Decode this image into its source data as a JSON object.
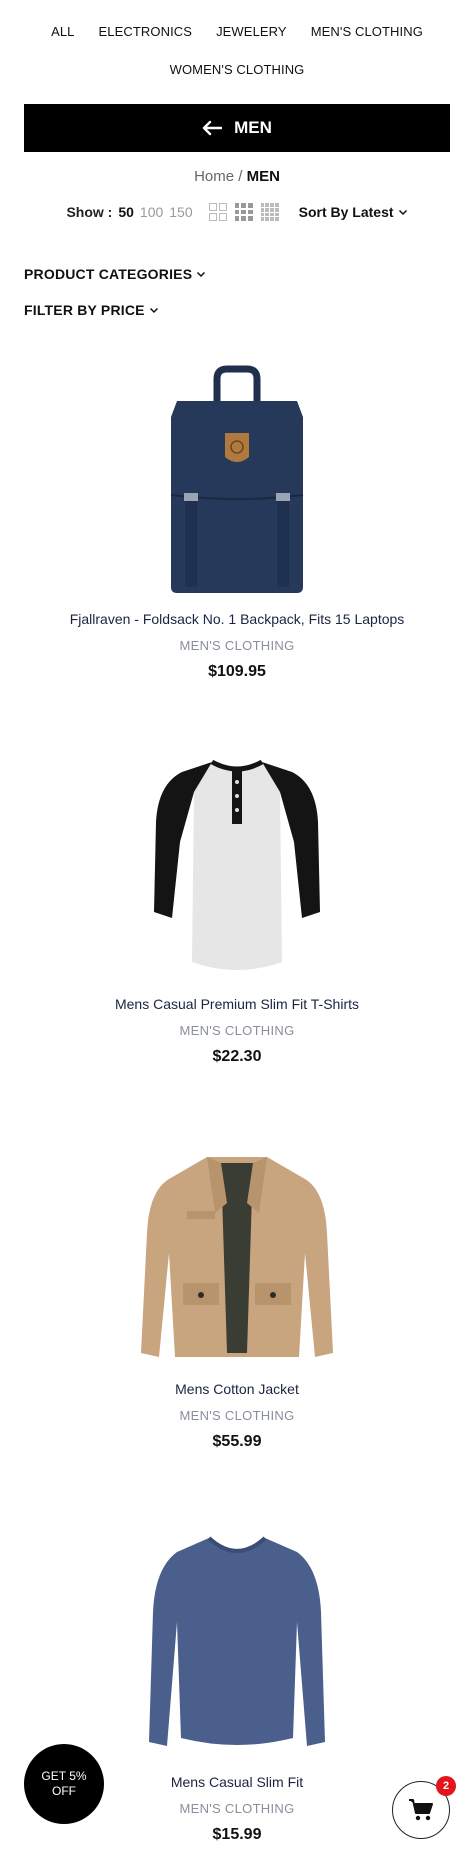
{
  "category_nav": {
    "items": [
      "ALL",
      "ELECTRONICS",
      "JEWELERY",
      "MEN'S CLOTHING",
      "WOMEN'S CLOTHING"
    ]
  },
  "back_bar": {
    "label": "MEN"
  },
  "breadcrumb": {
    "home": "Home",
    "separator": "/",
    "current": "MEN"
  },
  "toolbar": {
    "show_label": "Show :",
    "show_options": [
      "50",
      "100",
      "150"
    ],
    "show_selected": "50",
    "sort_label": "Sort By Latest"
  },
  "filters": {
    "categories_label": "PRODUCT CATEGORIES",
    "price_label": "FILTER BY PRICE"
  },
  "products": [
    {
      "title": "Fjallraven - Foldsack No. 1 Backpack, Fits 15 Laptops",
      "category": "MEN'S CLOTHING",
      "price": "$109.95",
      "image_icon": "backpack-image"
    },
    {
      "title": "Mens Casual Premium Slim Fit T-Shirts",
      "category": "MEN'S CLOTHING",
      "price": "$22.30",
      "image_icon": "raglan-shirt-image"
    },
    {
      "title": "Mens Cotton Jacket",
      "category": "MEN'S CLOTHING",
      "price": "$55.99",
      "image_icon": "jacket-image"
    },
    {
      "title": "Mens Casual Slim Fit",
      "category": "MEN'S CLOTHING",
      "price": "$15.99",
      "image_icon": "long-sleeve-shirt-image"
    }
  ],
  "promo": {
    "line1": "GET 5%",
    "line2": "OFF"
  },
  "cart": {
    "count": "2"
  },
  "colors": {
    "primary": "#000000",
    "badge": "#e3141a",
    "backpack": "#26395a",
    "jacket": "#c8a57f",
    "shirt_blue": "#4a5f8c"
  }
}
